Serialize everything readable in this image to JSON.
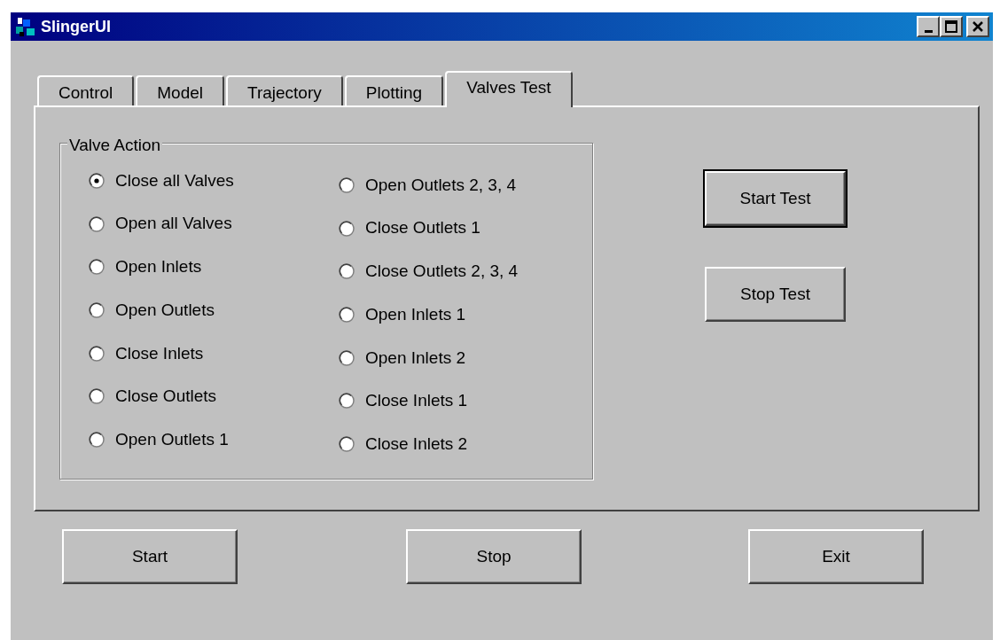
{
  "window": {
    "title": "SlingerUI"
  },
  "tabs": [
    {
      "label": "Control",
      "selected": false
    },
    {
      "label": "Model",
      "selected": false
    },
    {
      "label": "Trajectory",
      "selected": false
    },
    {
      "label": "Plotting",
      "selected": false
    },
    {
      "label": "Valves Test",
      "selected": true
    }
  ],
  "valve_action": {
    "title": "Valve Action",
    "options": [
      {
        "label": "Close all Valves",
        "selected": true
      },
      {
        "label": "Open all Valves",
        "selected": false
      },
      {
        "label": "Open Inlets",
        "selected": false
      },
      {
        "label": "Open Outlets",
        "selected": false
      },
      {
        "label": "Close Inlets",
        "selected": false
      },
      {
        "label": "Close Outlets",
        "selected": false
      },
      {
        "label": "Open Outlets 1",
        "selected": false
      },
      {
        "label": "Open Outlets 2, 3, 4",
        "selected": false
      },
      {
        "label": "Close Outlets 1",
        "selected": false
      },
      {
        "label": "Close Outlets 2, 3, 4",
        "selected": false
      },
      {
        "label": "Open Inlets 1",
        "selected": false
      },
      {
        "label": "Open Inlets 2",
        "selected": false
      },
      {
        "label": "Close Inlets 1",
        "selected": false
      },
      {
        "label": "Close Inlets 2",
        "selected": false
      }
    ]
  },
  "test_buttons": [
    {
      "label": "Start Test",
      "default": true
    },
    {
      "label": "Stop Test",
      "default": false
    }
  ],
  "buttons": [
    "Start",
    "Stop",
    "Exit"
  ]
}
